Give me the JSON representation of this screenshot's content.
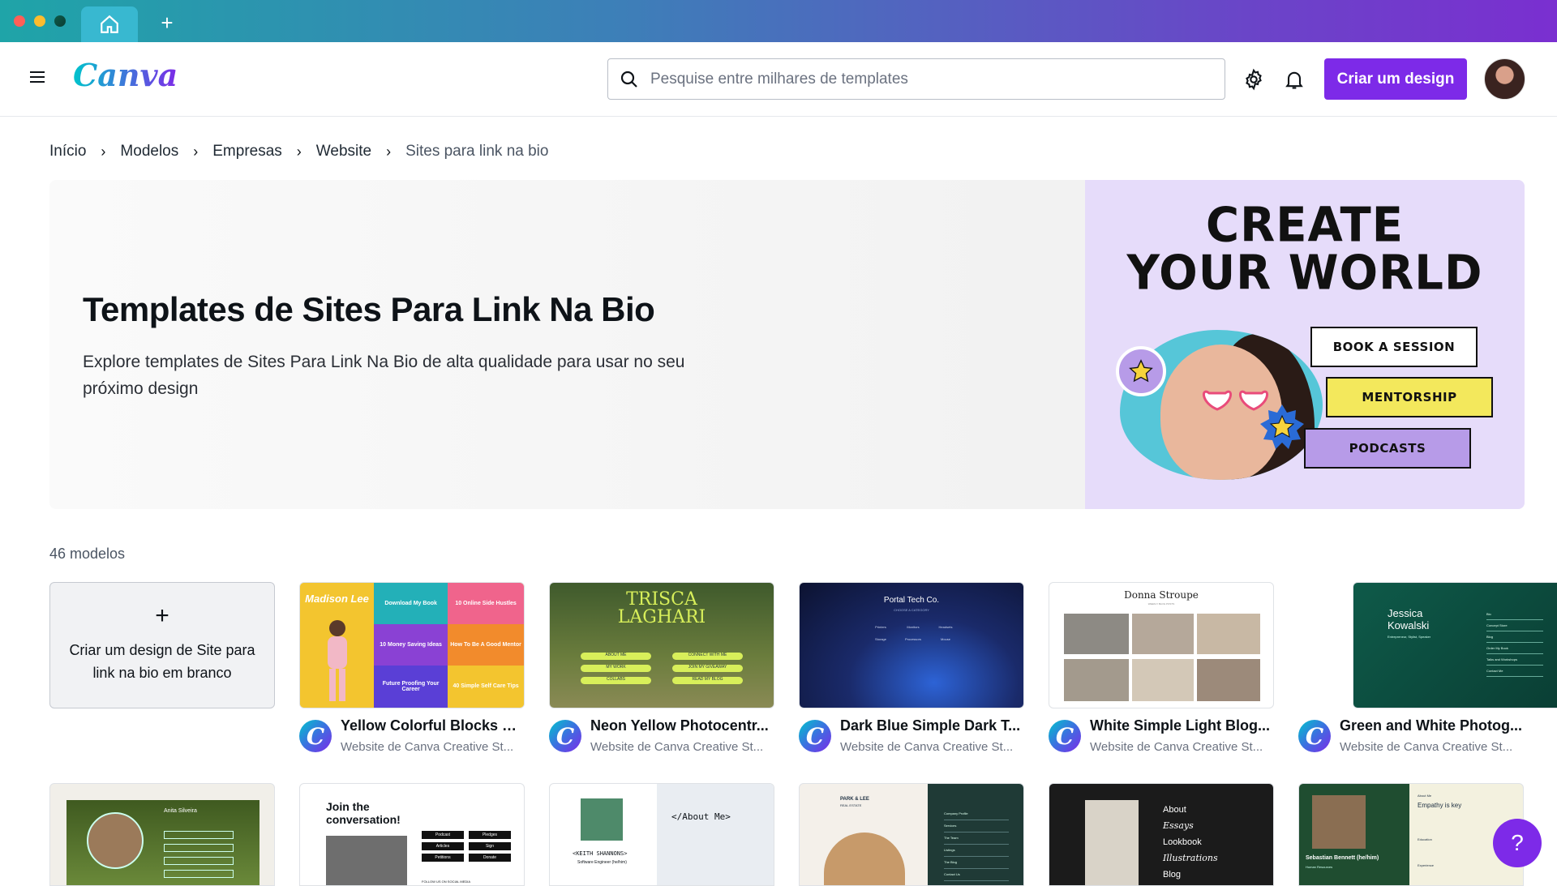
{
  "header": {
    "logo": "Canva",
    "search_placeholder": "Pesquise entre milhares de templates",
    "create_button": "Criar um design"
  },
  "breadcrumb": [
    "Início",
    "Modelos",
    "Empresas",
    "Website",
    "Sites para link na bio"
  ],
  "hero": {
    "title": "Templates de Sites Para Link Na Bio",
    "description": "Explore templates de Sites Para Link Na Bio de alta qualidade para usar no seu próximo design",
    "art_title_line1": "CREATE",
    "art_title_line2": "YOUR WORLD",
    "art_buttons": [
      "BOOK A SESSION",
      "MENTORSHIP",
      "PODCASTS"
    ]
  },
  "count": "46 modelos",
  "blank_card": {
    "label": "Criar um design de Site para link na bio em branco"
  },
  "templates": [
    {
      "title": "Yellow Colorful Blocks B...",
      "subtitle": "Website de Canva Creative St...",
      "thumb_text": [
        "Madison Lee",
        "Download My Book",
        "10 Online Side Hustles",
        "10 Money Saving Ideas",
        "How To Be A Good Mentor",
        "Future Proofing Your Career",
        "40 Simple Self Care Tips"
      ]
    },
    {
      "title": "Neon Yellow Photocentr...",
      "subtitle": "Website de Canva Creative St...",
      "thumb_text": [
        "TRISCA",
        "LAGHARI",
        "ABOUT ME",
        "CONNECT WITH ME",
        "MY WORK",
        "JOIN MY GIVEAWAY",
        "COLLABS",
        "READ MY BLOG"
      ]
    },
    {
      "title": "Dark Blue Simple Dark T...",
      "subtitle": "Website de Canva Creative St...",
      "thumb_text": [
        "Portal Tech Co.",
        "CHOOSE A CATEGORY",
        "Printers",
        "Monitors",
        "Headsets",
        "Storage",
        "Processors",
        "Mouse"
      ]
    },
    {
      "title": "White Simple Light Blog...",
      "subtitle": "Website de Canva Creative St...",
      "thumb_text": [
        "Donna Stroupe",
        "WEEKLY BLOG POSTS"
      ]
    },
    {
      "title": "Green and White Photog...",
      "subtitle": "Website de Canva Creative St...",
      "thumb_text": [
        "Jessica",
        "Kowalski",
        "Entrepreneur, Stylist, Speaker",
        "Bio",
        "Concept Store",
        "Blog",
        "Order My Book",
        "Talks and Workshops",
        "Contact Me"
      ]
    }
  ],
  "row2": [
    {
      "thumb_text": [
        "Anita Silveira"
      ]
    },
    {
      "thumb_text": [
        "Join the",
        "conversation!",
        "Podcast",
        "Pledges",
        "Articles",
        "Sign",
        "Petitions",
        "Donate",
        "FOLLOW US ON SOCIAL MEDIA"
      ]
    },
    {
      "thumb_text": [
        "</About Me>",
        "<KEITH SHANNONS>",
        "Software Engineer (he/him)"
      ]
    },
    {
      "thumb_text": [
        "PARK & LEE",
        "REAL ESTATE",
        "Company Profile",
        "Services",
        "The Team",
        "Listings",
        "The Blog",
        "Contact Us"
      ]
    },
    {
      "thumb_text": [
        "About",
        "Essays",
        "Lookbook",
        "Illustrations",
        "Blog"
      ]
    },
    {
      "thumb_text": [
        "Sebastian Bennett (he/him)",
        "Human Resources",
        "About Me",
        "Empathy is key",
        "Education",
        "Experience"
      ]
    }
  ],
  "help": "?",
  "colors": {
    "accent": "#7d2ae8",
    "brand_teal": "#00c4cc"
  }
}
